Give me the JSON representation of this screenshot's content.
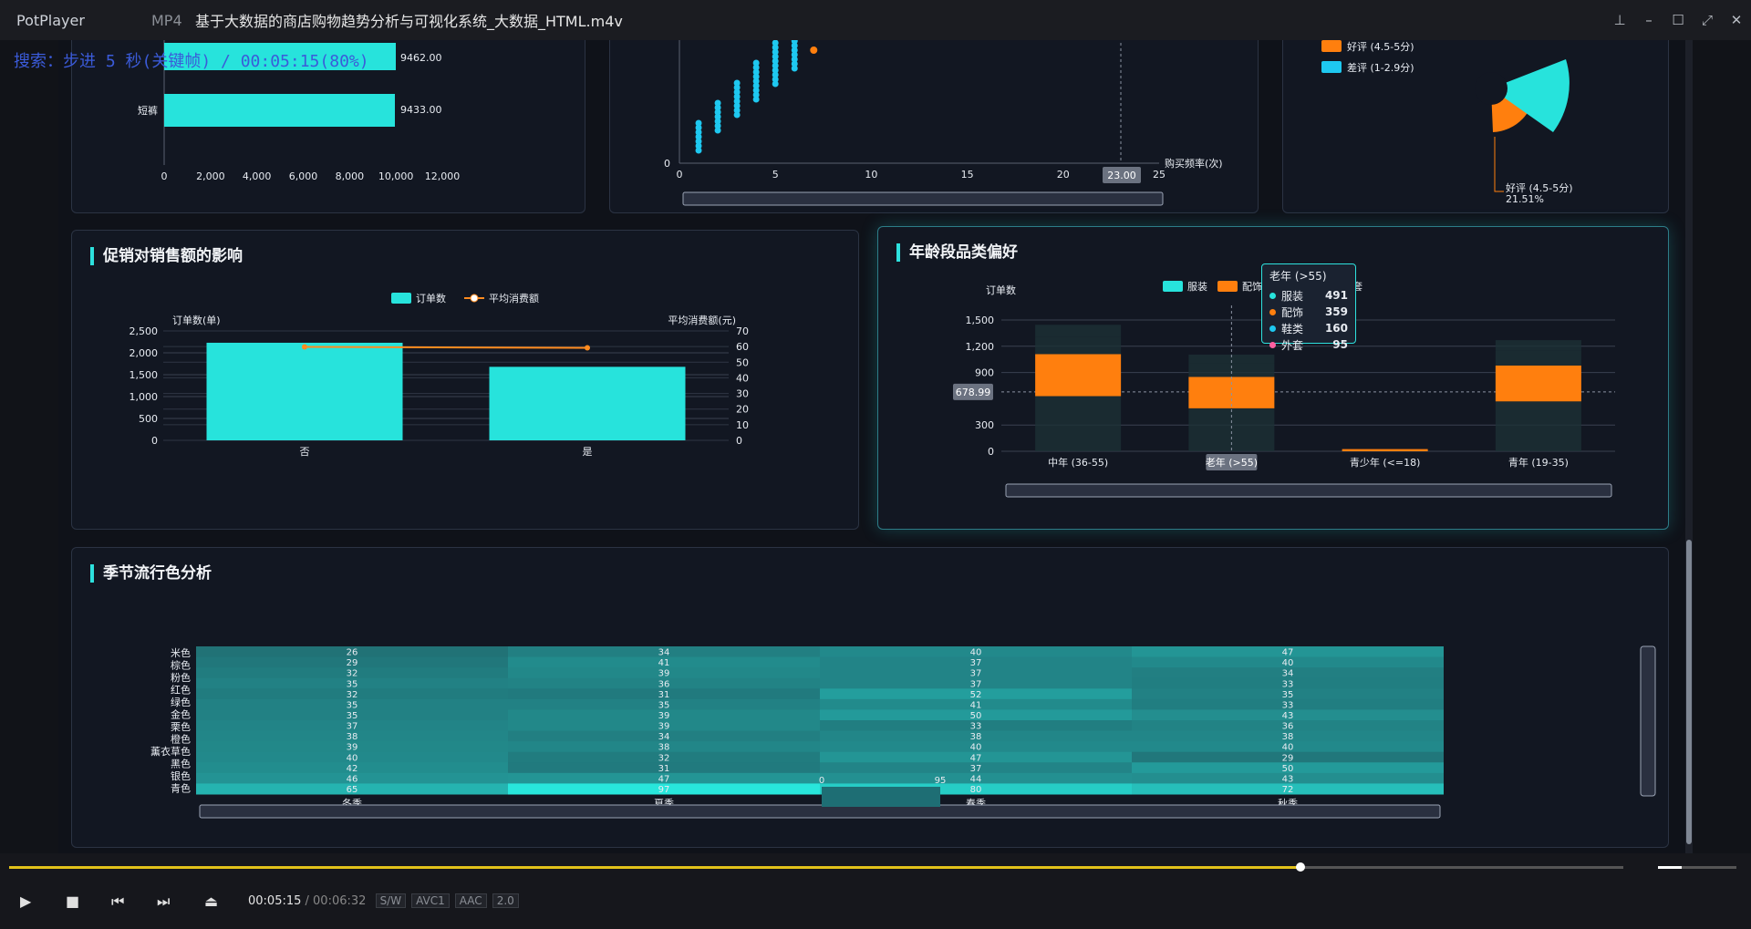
{
  "titlebar": {
    "app": "PotPlayer",
    "format": "MP4",
    "title": "基于大数据的商店购物趋势分析与可视化系统_大数据_HTML.m4v"
  },
  "osd": "搜索：步进 5 秒(关键帧) / 00:05:15(80%)",
  "panels": {
    "promo": {
      "title": "促销对销售额的影响"
    },
    "age": {
      "title": "年龄段品类偏好"
    },
    "season": {
      "title": "季节流行色分析"
    }
  },
  "chart_data": [
    {
      "type": "bar",
      "orientation": "horizontal",
      "categories": [
        "",
        "短裤"
      ],
      "values": [
        9462.0,
        9433.0
      ],
      "value_labels": [
        "9462.00",
        "9433.00"
      ],
      "xlim": [
        0,
        12000
      ],
      "xticks": [
        "0",
        "2,000",
        "4,000",
        "6,000",
        "8,000",
        "10,000",
        "12,000"
      ]
    },
    {
      "type": "scatter",
      "xlabel": "购买频率(次)",
      "xlim": [
        0,
        25
      ],
      "xticks": [
        "0",
        "5",
        "10",
        "15",
        "20",
        "25"
      ],
      "yticks": [
        "0"
      ],
      "marker_label": "23.00",
      "colors": [
        "#1ec8f0",
        "#ff7f0e"
      ]
    },
    {
      "type": "pie",
      "legend": [
        "好评 (4.5-5分)",
        "差评 (1-2.9分)"
      ],
      "annotation": {
        "label": "好评 (4.5-5分)",
        "value": "21.51%"
      }
    },
    {
      "type": "bar",
      "title": "促销对销售额的影响",
      "categories": [
        "否",
        "是"
      ],
      "legend": [
        "订单数",
        "平均消费额"
      ],
      "series": [
        {
          "name": "订单数",
          "type": "bar",
          "values": [
            2230,
            1680
          ],
          "color": "#27e3dc"
        },
        {
          "name": "平均消费额",
          "type": "line",
          "values": [
            59.8,
            59.2
          ],
          "color": "#ff8b1f"
        }
      ],
      "ylabel": "订单数(单)",
      "ylabel2": "平均消费额(元)",
      "ylim": [
        0,
        2500
      ],
      "ylim2": [
        0,
        70
      ],
      "yticks": [
        "0",
        "500",
        "1,000",
        "1,500",
        "2,000",
        "2,500"
      ],
      "yticks2": [
        "0",
        "10",
        "20",
        "30",
        "40",
        "50",
        "60",
        "70"
      ]
    },
    {
      "type": "bar",
      "stacked": true,
      "title": "年龄段品类偏好",
      "categories": [
        "中年 (36-55)",
        "老年 (>55)",
        "青少年 (<=18)",
        "青年 (19-35)"
      ],
      "legend": [
        "服装",
        "配饰",
        "外套"
      ],
      "series": [
        {
          "name": "服装",
          "values": [
            630,
            491,
            0,
            570
          ],
          "color": "#27e3dc"
        },
        {
          "name": "配饰",
          "values": [
            480,
            359,
            25,
            410
          ],
          "color": "#ff7f0e"
        },
        {
          "name": "鞋类",
          "values": [
            200,
            160,
            0,
            170
          ],
          "color": "#1ec8f0"
        },
        {
          "name": "外套",
          "values": [
            135,
            95,
            0,
            120
          ],
          "color": "#ff5fa0"
        }
      ],
      "ylabel": "订单数",
      "ylim": [
        0,
        1500
      ],
      "yticks": [
        "0",
        "300",
        "678.99",
        "900",
        "1,200",
        "1,500"
      ],
      "axis_pointer": "678.99",
      "tooltip": {
        "title": "老年 (>55)",
        "items": [
          {
            "name": "服装",
            "value": "491",
            "color": "#27e3dc"
          },
          {
            "name": "配饰",
            "value": "359",
            "color": "#ff7f0e"
          },
          {
            "name": "鞋类",
            "value": "160",
            "color": "#1ec8f0"
          },
          {
            "name": "外套",
            "value": "95",
            "color": "#ff5fa0"
          }
        ]
      }
    },
    {
      "type": "heatmap",
      "title": "季节流行色分析",
      "x": [
        "冬季",
        "夏季",
        "春季",
        "秋季"
      ],
      "y": [
        "米色",
        "棕色",
        "粉色",
        "红色",
        "绿色",
        "金色",
        "栗色",
        "橙色",
        "薰衣草色",
        "黑色",
        "银色",
        "青色"
      ],
      "values": [
        [
          26,
          29,
          32,
          35,
          32,
          35,
          35,
          37,
          38,
          39,
          40,
          42,
          46,
          65
        ],
        [
          34,
          41,
          39,
          36,
          31,
          35,
          39,
          39,
          34,
          38,
          32,
          31,
          47,
          97
        ],
        [
          40,
          37,
          37,
          37,
          52,
          41,
          50,
          33,
          38,
          40,
          47,
          37,
          44,
          80
        ],
        [
          47,
          40,
          34,
          33,
          35,
          33,
          43,
          36,
          38,
          40,
          29,
          50,
          43,
          72
        ]
      ],
      "visual_map": {
        "min": "0",
        "max": "95"
      },
      "note": "values listed top-to-bottom per season column as printed"
    }
  ]
}
